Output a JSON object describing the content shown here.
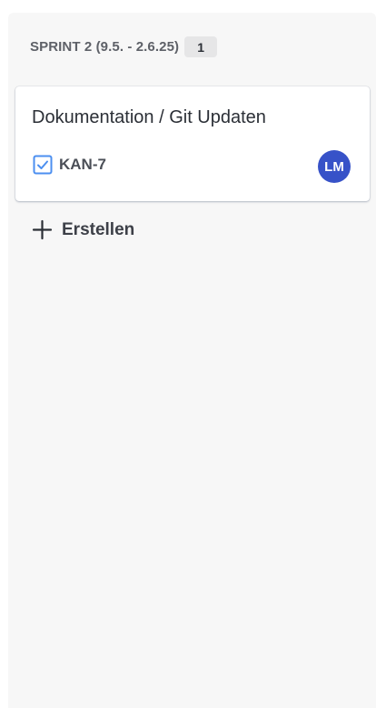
{
  "column": {
    "title": "SPRINT 2 (9.5. - 2.6.25)",
    "count": "1"
  },
  "cards": [
    {
      "title": "Dokumentation / Git Updaten",
      "issue_key": "KAN-7",
      "issue_type_icon": "checkbox-task-icon",
      "assignee_initials": "LM",
      "assignee_color": "#3752c8"
    }
  ],
  "create_button": {
    "label": "Erstellen",
    "icon": "plus-icon"
  },
  "colors": {
    "column_bg": "#f7f7f7",
    "task_icon": "#4c8ff0"
  }
}
